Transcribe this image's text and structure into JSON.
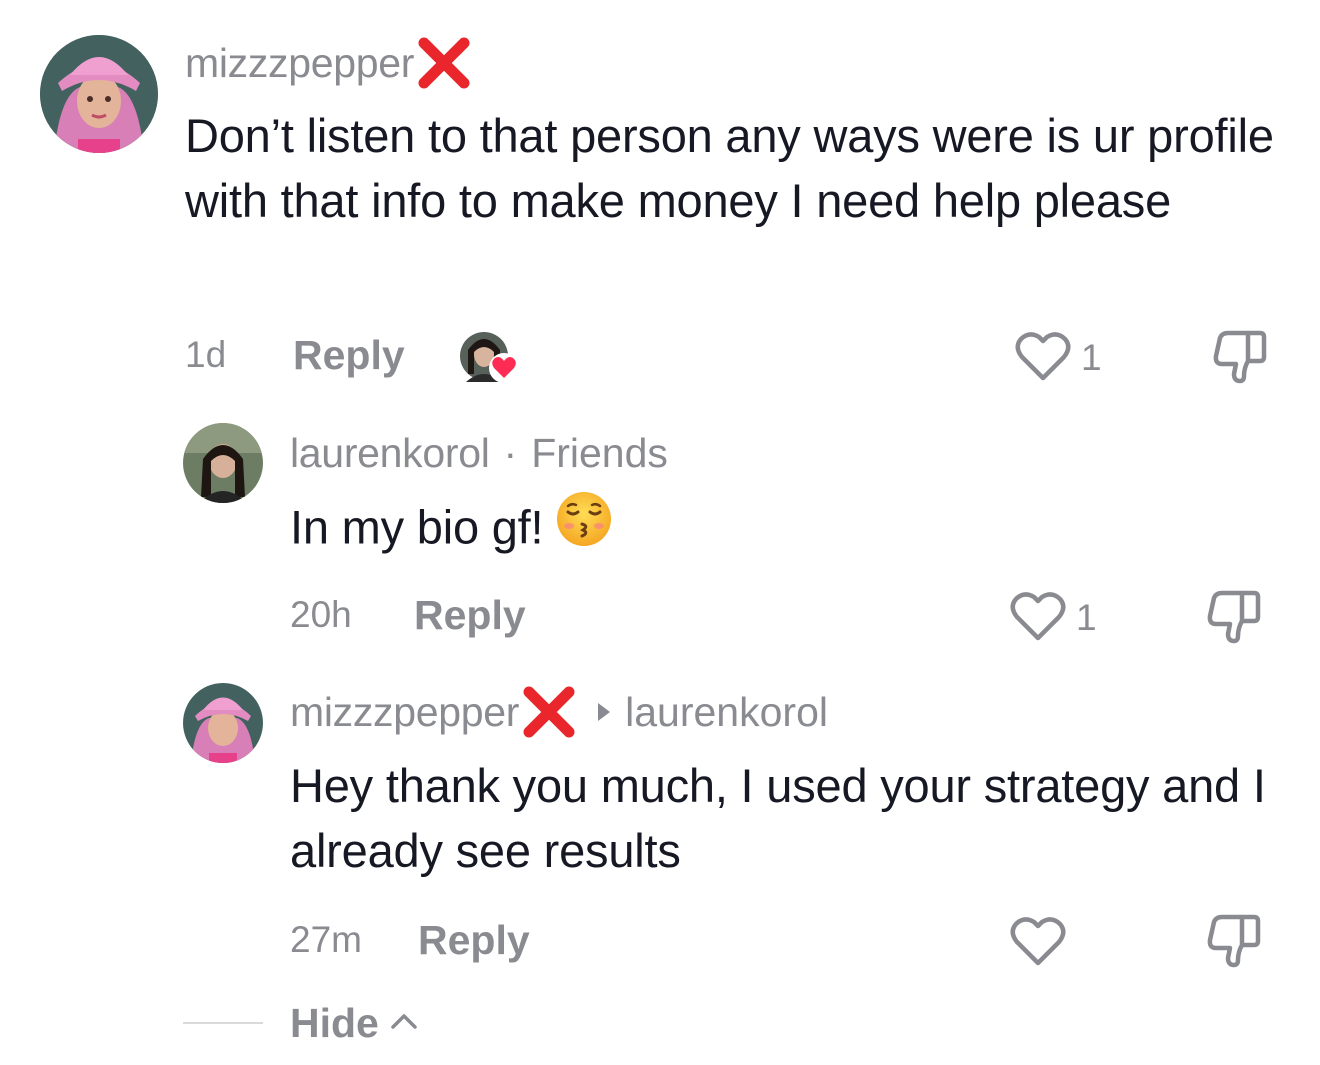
{
  "comments": [
    {
      "username": "mizzzpepper",
      "text": "Don’t listen to that person any ways were is ur profile with that info to make money I need help please",
      "time": "1d",
      "reply_label": "Reply",
      "like_count": "1",
      "liked_by_creator": true
    },
    {
      "username": "laurenkorol",
      "tag_separator": "·",
      "tag": "Friends",
      "text": "In my bio gf!",
      "emoji": "kissing-face-with-closed-eyes",
      "time": "20h",
      "reply_label": "Reply",
      "like_count": "1"
    },
    {
      "username": "mizzzpepper",
      "reply_to": "laurenkorol",
      "text": "Hey thank you much, I used your strategy and I already see results",
      "time": "27m",
      "reply_label": "Reply",
      "like_count": ""
    }
  ],
  "hide_label": "Hide",
  "colors": {
    "muted_text": "#8a8b91",
    "primary_text": "#161823",
    "x_mark": "#e8262b",
    "heart_badge": "#fe2c55"
  }
}
